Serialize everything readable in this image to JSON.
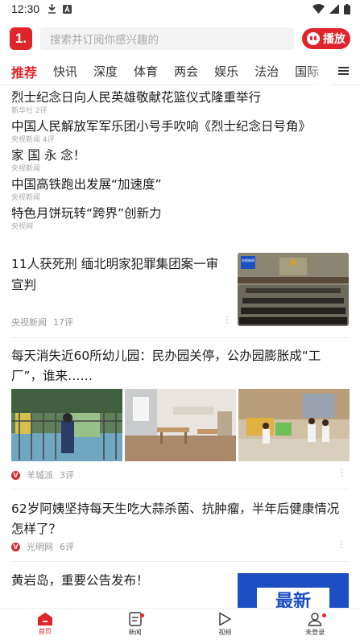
{
  "status_bar": {
    "time": "12:30"
  },
  "search": {
    "logo_text": "1.",
    "placeholder": "搜索并订阅你感兴趣的",
    "play_label": "播放"
  },
  "tabs": [
    {
      "label": "推荐",
      "active": true
    },
    {
      "label": "快讯"
    },
    {
      "label": "深度"
    },
    {
      "label": "体育"
    },
    {
      "label": "两会"
    },
    {
      "label": "娱乐"
    },
    {
      "label": "法治"
    },
    {
      "label": "国际"
    }
  ],
  "headlines": [
    {
      "title": "烈士纪念日向人民英雄敬献花篮仪式隆重举行",
      "meta": "新华社   2评"
    },
    {
      "title": "中国人民解放军军乐团小号手吹响《烈士纪念日号角》",
      "meta": "央视新闻   4评"
    },
    {
      "title": "家 国 永 念！",
      "meta": "央视新闻"
    },
    {
      "title": "中国高铁跑出发展“加速度”",
      "meta": "央视新闻"
    },
    {
      "title": "特色月饼玩转“跨界”创新力",
      "meta": "央视网"
    }
  ],
  "cards": [
    {
      "title": "11人获死刑 缅北明家犯罪集团案一审宣判",
      "source": "央视新闻",
      "comments": "17评",
      "image_badge": "央视新闻"
    },
    {
      "title": "每天消失近60所幼儿园：民办园关停，公办园膨胀成“工厂”，谁来……",
      "source": "羊城派",
      "comments": "3评"
    },
    {
      "title": "62岁阿姨坚持每天生吃大蒜杀菌、抗肿瘤，半年后健康情况怎样了？",
      "source": "光明网",
      "comments": "6评"
    },
    {
      "title": "黄岩岛，重要公告发布！",
      "image_text": "最新"
    }
  ],
  "bottom_nav": [
    {
      "label": "首页",
      "icon": "home-icon",
      "active": true
    },
    {
      "label": "新闻",
      "icon": "news-icon",
      "badge": true
    },
    {
      "label": "视频",
      "icon": "video-icon"
    },
    {
      "label": "未登录",
      "icon": "user-icon",
      "badge": true
    }
  ],
  "colors": {
    "accent": "#e0242b"
  }
}
